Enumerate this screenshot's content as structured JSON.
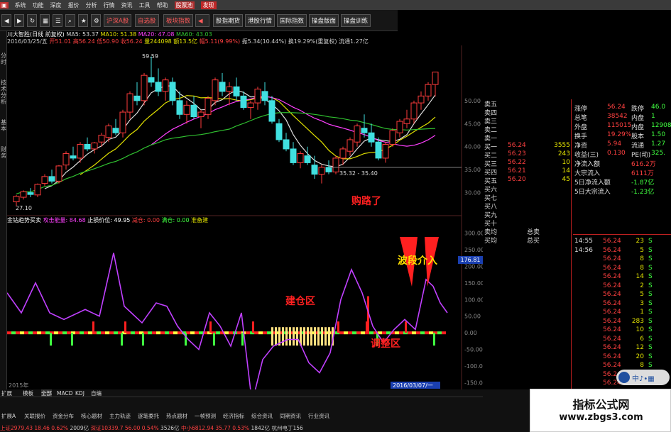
{
  "menu": [
    "系统",
    "功能",
    "深度",
    "报价",
    "分析",
    "行情",
    "资讯",
    "工具",
    "帮助",
    "股票池",
    "发现"
  ],
  "toolbar": [
    "沪深A股",
    "自选股",
    "板块指数",
    "股指期货",
    "港股行情",
    "国际指数",
    "操盘版面",
    "操盘训练"
  ],
  "stock": {
    "name": "川大智胜(日线 前复权)",
    "ma5": "MA5: 53.37",
    "ma10": "MA10: 51.38",
    "ma20": "MA20: 47.08",
    "ma60": "MA60: 43.03",
    "date": "2016/03/25/五",
    "open": "开51.01",
    "high": "高56.24",
    "low": "低50.90",
    "close": "收56.24",
    "vol": "量244098",
    "amount": "额13.5亿",
    "change": "幅5.11(9.99%)",
    "amp": "振5.34(10.44%)",
    "turnover": "换19.29%(重复权)",
    "float": "流通1.27亿"
  },
  "price_labels": {
    "high": "59.59",
    "range": "35.32 - 35.40",
    "low": "27.10"
  },
  "yaxis_top": [
    "50.00",
    "45.00",
    "40.00",
    "35.00",
    "30.00"
  ],
  "yaxis_bottom": [
    "300.00",
    "250.00",
    "200.00",
    "150.00",
    "100.00",
    "50.00",
    "0.00",
    "-50.00",
    "-100.00",
    "-150.00"
  ],
  "indicator": {
    "name": "金钻趋势买卖",
    "attack": "攻击能量: 84.68",
    "stop": "止损价位: 49.95",
    "reduce": "减仓: 0.00",
    "add": "满仓: 0.00",
    "prepare": "准备建",
    "badge": "176.81"
  },
  "annotations": {
    "buy": "购路了",
    "build": "建仓区",
    "adjust": "调整区",
    "wave": "波段介入"
  },
  "lefttabs": [
    "分时",
    "技术分析",
    "基本",
    "财务"
  ],
  "date_label": "2016/03/07/一",
  "year_label": "2015年",
  "orderbook": {
    "sell": [
      [
        "卖五",
        ""
      ],
      [
        "卖四",
        ""
      ],
      [
        "卖三",
        ""
      ],
      [
        "卖二",
        ""
      ],
      [
        "卖一",
        ""
      ]
    ],
    "buy": [
      [
        "买一",
        "56.24",
        "3555"
      ],
      [
        "买二",
        "56.23",
        "243"
      ],
      [
        "买三",
        "56.22",
        "10"
      ],
      [
        "买四",
        "56.21",
        "14"
      ],
      [
        "买五",
        "56.20",
        "45"
      ],
      [
        "买六",
        "",
        ""
      ],
      [
        "买七",
        "",
        ""
      ],
      [
        "买八",
        "",
        ""
      ],
      [
        "买九",
        "",
        ""
      ],
      [
        "买十",
        "",
        ""
      ]
    ],
    "avg_sell": "卖均",
    "avg_buy": "买均",
    "total_sell": "总卖",
    "total_buy": "总买"
  },
  "quote": [
    [
      "涨停",
      "56.24",
      "跌停",
      "46.0"
    ],
    [
      "总笔",
      "38542",
      "内盘",
      "1"
    ],
    [
      "外盘",
      "115015",
      "内盘",
      "12908"
    ],
    [
      "换手",
      "19.29%",
      "股本",
      "1.50"
    ],
    [
      "净资",
      "5.94",
      "流通",
      "1.27"
    ],
    [
      "收益(三)",
      "0.130",
      "PE(动)",
      "325."
    ],
    [
      "净流入额",
      "",
      "616.2万",
      ""
    ],
    [
      "大宗流入",
      "",
      "6111万",
      ""
    ],
    [
      "5日净流入额",
      "",
      "-1.87亿",
      ""
    ],
    [
      "5日大宗流入",
      "",
      "-1.23亿",
      ""
    ]
  ],
  "ticks": [
    [
      "14:55",
      "56.24",
      "23",
      "S"
    ],
    [
      "14:56",
      "56.24",
      "5",
      "S"
    ],
    [
      "",
      "56.24",
      "8",
      "S"
    ],
    [
      "",
      "56.24",
      "8",
      "S"
    ],
    [
      "",
      "56.24",
      "14",
      "S"
    ],
    [
      "",
      "56.24",
      "2",
      "S"
    ],
    [
      "",
      "56.24",
      "5",
      "S"
    ],
    [
      "",
      "56.24",
      "3",
      "S"
    ],
    [
      "",
      "56.24",
      "1",
      "S"
    ],
    [
      "",
      "56.24",
      "283",
      "S"
    ],
    [
      "",
      "56.24",
      "10",
      "S"
    ],
    [
      "",
      "56.24",
      "6",
      "S"
    ],
    [
      "",
      "56.24",
      "12",
      "S"
    ],
    [
      "",
      "56.24",
      "20",
      "S"
    ],
    [
      "",
      "56.24",
      "8",
      "S"
    ],
    [
      "",
      "56.24",
      "15",
      "S"
    ],
    [
      "",
      "56.24",
      "3",
      "S"
    ]
  ],
  "bottom_tabs": [
    "扩展",
    "模板",
    "全部",
    "MACD",
    "KDJ",
    "自编"
  ],
  "bottom_links": [
    "扩展A",
    "关联报价",
    "资金分布",
    "核心题材",
    "主力轨迹",
    "逐笔委托",
    "热点题材",
    "一帧预测",
    "经济指标",
    "综合资讯",
    "同期资讯",
    "行业资讯"
  ],
  "status": {
    "sh": "上证2979.43",
    "sh_chg": "18.46",
    "sh_pct": "0.62%",
    "sh_amt": "2009亿",
    "sz": "深证10339.7",
    "sz_chg": "56.00",
    "sz_pct": "0.54%",
    "sz_amt": "3526亿",
    "mid": "中小6812.94",
    "mid_chg": "35.77",
    "mid_pct": "0.53%",
    "mid_amt": "1842亿",
    "city": "杭州电丁156"
  },
  "watermark": {
    "line1": "指标公式网",
    "line2": "www.zbgs3.com"
  },
  "colors": {
    "up": "#ff3c3c",
    "down": "#40e0e0",
    "ma5": "#dddddd",
    "ma10": "#e0e000",
    "ma20": "#ff40ff",
    "ma60": "#30c030",
    "macd_line": "#c040ff",
    "bar_red": "#ff2020",
    "bar_green": "#40ff40",
    "bar_yellow": "#ffff40"
  },
  "candles": [
    [
      28,
      29.5,
      27.1,
      29.2
    ],
    [
      29,
      30.5,
      28.5,
      30.2
    ],
    [
      30,
      31,
      29,
      29.6
    ],
    [
      29.5,
      32,
      29,
      31.8
    ],
    [
      32,
      34,
      31.5,
      33.5
    ],
    [
      33.5,
      35,
      32,
      32.5
    ],
    [
      32.5,
      36,
      32,
      35.8
    ],
    [
      36,
      39,
      35,
      38.5
    ],
    [
      38,
      40,
      37,
      37.5
    ],
    [
      37.5,
      41,
      36.5,
      40.5
    ],
    [
      40.5,
      42,
      39,
      39.5
    ],
    [
      39.5,
      41,
      38.5,
      40.8
    ],
    [
      41,
      43,
      40,
      42.5
    ],
    [
      42,
      45,
      41,
      44.5
    ],
    [
      44,
      46,
      42.5,
      43
    ],
    [
      43,
      48,
      42,
      47.5
    ],
    [
      47.5,
      52,
      46,
      51.5
    ],
    [
      51,
      54,
      49,
      50
    ],
    [
      50,
      56,
      49,
      55.5
    ],
    [
      55,
      59.6,
      53,
      54
    ],
    [
      54,
      57,
      51,
      52
    ],
    [
      52,
      55,
      50,
      54.5
    ],
    [
      54,
      55,
      49,
      50
    ],
    [
      50,
      52,
      46,
      47
    ],
    [
      47,
      50,
      45,
      49
    ],
    [
      49,
      51,
      46,
      46.5
    ],
    [
      46.5,
      48,
      44,
      47.5
    ],
    [
      47,
      51,
      46,
      50.5
    ],
    [
      50,
      55,
      49,
      54.5
    ],
    [
      54,
      56,
      51,
      52
    ],
    [
      52,
      54,
      49,
      53
    ],
    [
      53,
      55,
      50,
      51
    ],
    [
      51,
      52,
      48,
      48.5
    ],
    [
      48.5,
      50,
      46,
      49.5
    ],
    [
      49.5,
      53,
      48,
      52.5
    ],
    [
      52,
      54,
      49,
      50
    ],
    [
      50,
      51,
      45,
      45.5
    ],
    [
      45,
      46,
      41,
      41.5
    ],
    [
      41.5,
      43,
      39,
      39.5
    ],
    [
      39.5,
      41,
      36,
      36.5
    ],
    [
      36.5,
      39,
      35.3,
      38.5
    ],
    [
      38,
      40,
      36,
      36.5
    ],
    [
      36,
      38,
      33,
      34
    ],
    [
      34,
      36,
      32,
      35.5
    ],
    [
      35.5,
      37,
      34,
      34.5
    ],
    [
      34.5,
      38,
      34,
      37.5
    ],
    [
      37.5,
      40,
      36,
      39.5
    ],
    [
      39,
      42,
      38,
      41.5
    ],
    [
      41,
      45,
      40,
      44.5
    ],
    [
      44,
      47,
      42,
      43
    ],
    [
      43,
      45,
      40,
      41
    ],
    [
      41,
      42,
      37,
      37.5
    ],
    [
      37.5,
      41,
      36.5,
      40.5
    ],
    [
      40.5,
      44,
      40,
      43.5
    ],
    [
      43,
      46,
      42,
      45.5
    ],
    [
      45,
      48,
      44,
      46
    ],
    [
      46,
      50,
      45,
      49.5
    ],
    [
      49.5,
      52,
      48,
      51
    ],
    [
      51,
      54,
      50,
      53.5
    ],
    [
      53.5,
      56.3,
      50.9,
      56.2
    ]
  ]
}
